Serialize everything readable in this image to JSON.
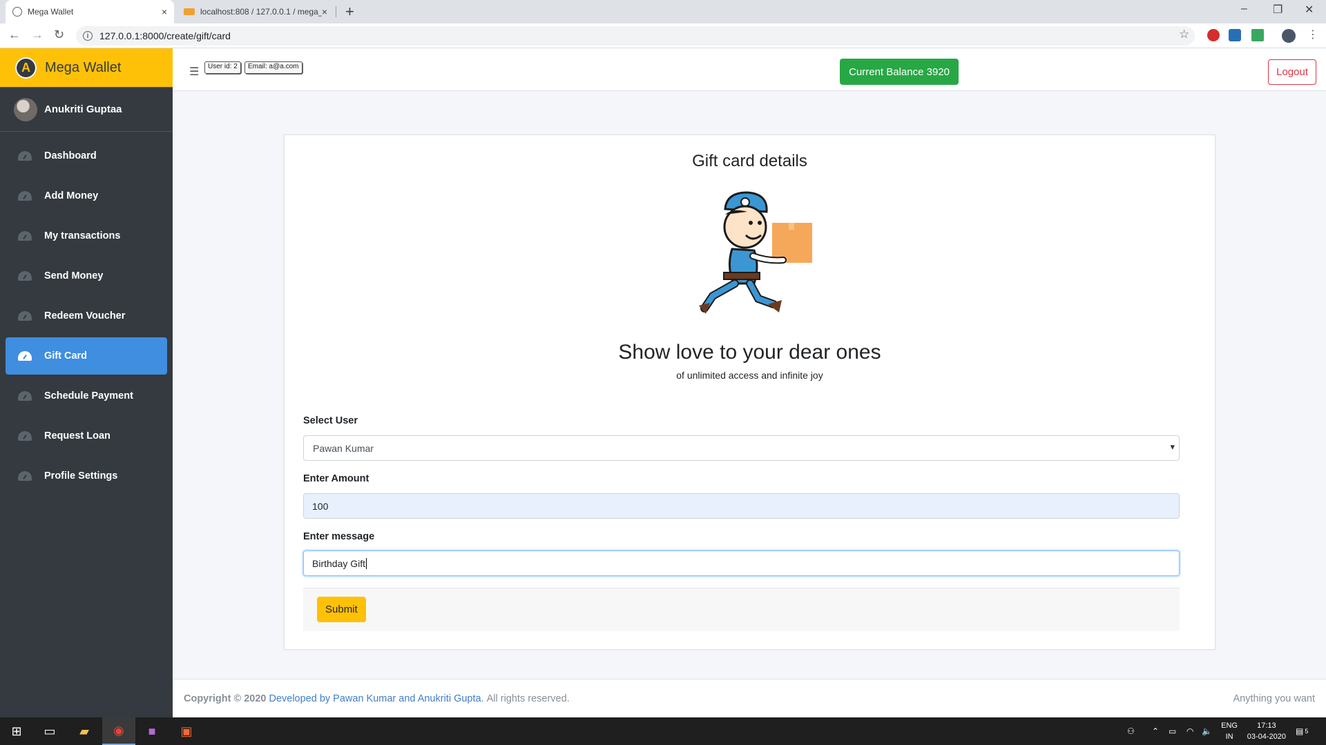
{
  "browser": {
    "tabs": [
      {
        "title": "Mega Wallet",
        "active": true
      },
      {
        "title": "localhost:808 / 127.0.0.1 / mega_",
        "active": false
      }
    ],
    "url": "127.0.0.1:8000/create/gift/card",
    "new_tab": "+",
    "close_glyph": "×"
  },
  "sidebar": {
    "brand": "Mega Wallet",
    "brand_logo": "A",
    "user_name": "Anukriti Guptaa",
    "items": [
      {
        "label": "Dashboard",
        "active": false
      },
      {
        "label": "Add Money",
        "active": false
      },
      {
        "label": "My transactions",
        "active": false
      },
      {
        "label": "Send Money",
        "active": false
      },
      {
        "label": "Redeem Voucher",
        "active": false
      },
      {
        "label": "Gift Card",
        "active": true
      },
      {
        "label": "Schedule Payment",
        "active": false
      },
      {
        "label": "Request Loan",
        "active": false
      },
      {
        "label": "Profile Settings",
        "active": false
      }
    ]
  },
  "topnav": {
    "user_id": "User id: 2",
    "email": "Email: a@a.com",
    "balance": "Current Balance 3920",
    "logout": "Logout"
  },
  "card": {
    "title": "Gift card details",
    "heading": "Show love to your dear ones",
    "subheading": "of unlimited access and infinite joy",
    "select_user_label": "Select User",
    "select_user_value": "Pawan Kumar",
    "amount_label": "Enter Amount",
    "amount_value": "100",
    "message_label": "Enter message",
    "message_value": "Birthday Gift",
    "submit": "Submit"
  },
  "footer": {
    "copyright": "Copyright © 2020",
    "developer": "Developed by Pawan Kumar and Anukriti Gupta.",
    "rights": "All rights reserved.",
    "right_text": "Anything you want"
  },
  "taskbar": {
    "lang_top": "ENG",
    "lang_bottom": "IN",
    "time": "17:13",
    "date": "03-04-2020",
    "notification_count": "5"
  },
  "colors": {
    "brand_yellow": "#ffc107",
    "sidebar_bg": "#343a40",
    "active_blue": "#3f8ee0",
    "success_green": "#28a745",
    "danger_red": "#dc3545"
  }
}
